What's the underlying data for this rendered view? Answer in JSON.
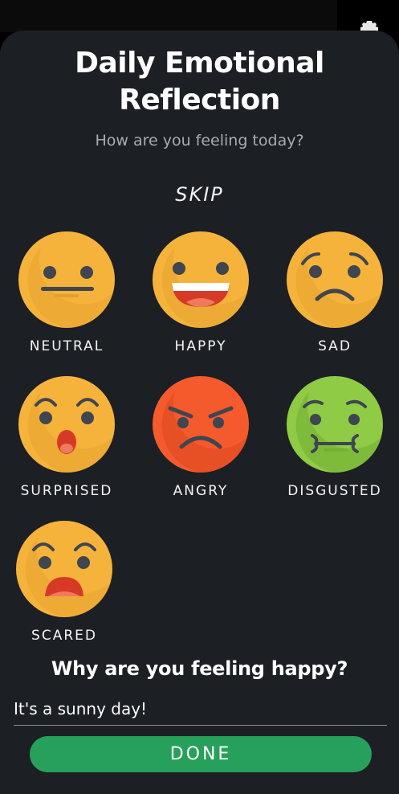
{
  "header": {
    "title_line1": "Daily Emotional",
    "title_line2": "Reflection",
    "subtitle": "How are you feeling today?",
    "skip_label": "SKIP"
  },
  "emotions": [
    {
      "label": "NEUTRAL",
      "icon": "neutral-face-icon"
    },
    {
      "label": "HAPPY",
      "icon": "happy-face-icon"
    },
    {
      "label": "SAD",
      "icon": "sad-face-icon"
    },
    {
      "label": "SURPRISED",
      "icon": "surprised-face-icon"
    },
    {
      "label": "ANGRY",
      "icon": "angry-face-icon"
    },
    {
      "label": "DISGUSTED",
      "icon": "disgusted-face-icon"
    },
    {
      "label": "SCARED",
      "icon": "scared-face-icon"
    }
  ],
  "reason": {
    "question": "Why are you feeling happy?",
    "value": "It's a sunny day!"
  },
  "actions": {
    "done_label": "DONE"
  },
  "colors": {
    "face_yellow": "#f5b33b",
    "face_red": "#f55a2c",
    "face_green": "#8fcb45",
    "done_green": "#27a05b",
    "sheet_bg": "#1c1f24"
  }
}
